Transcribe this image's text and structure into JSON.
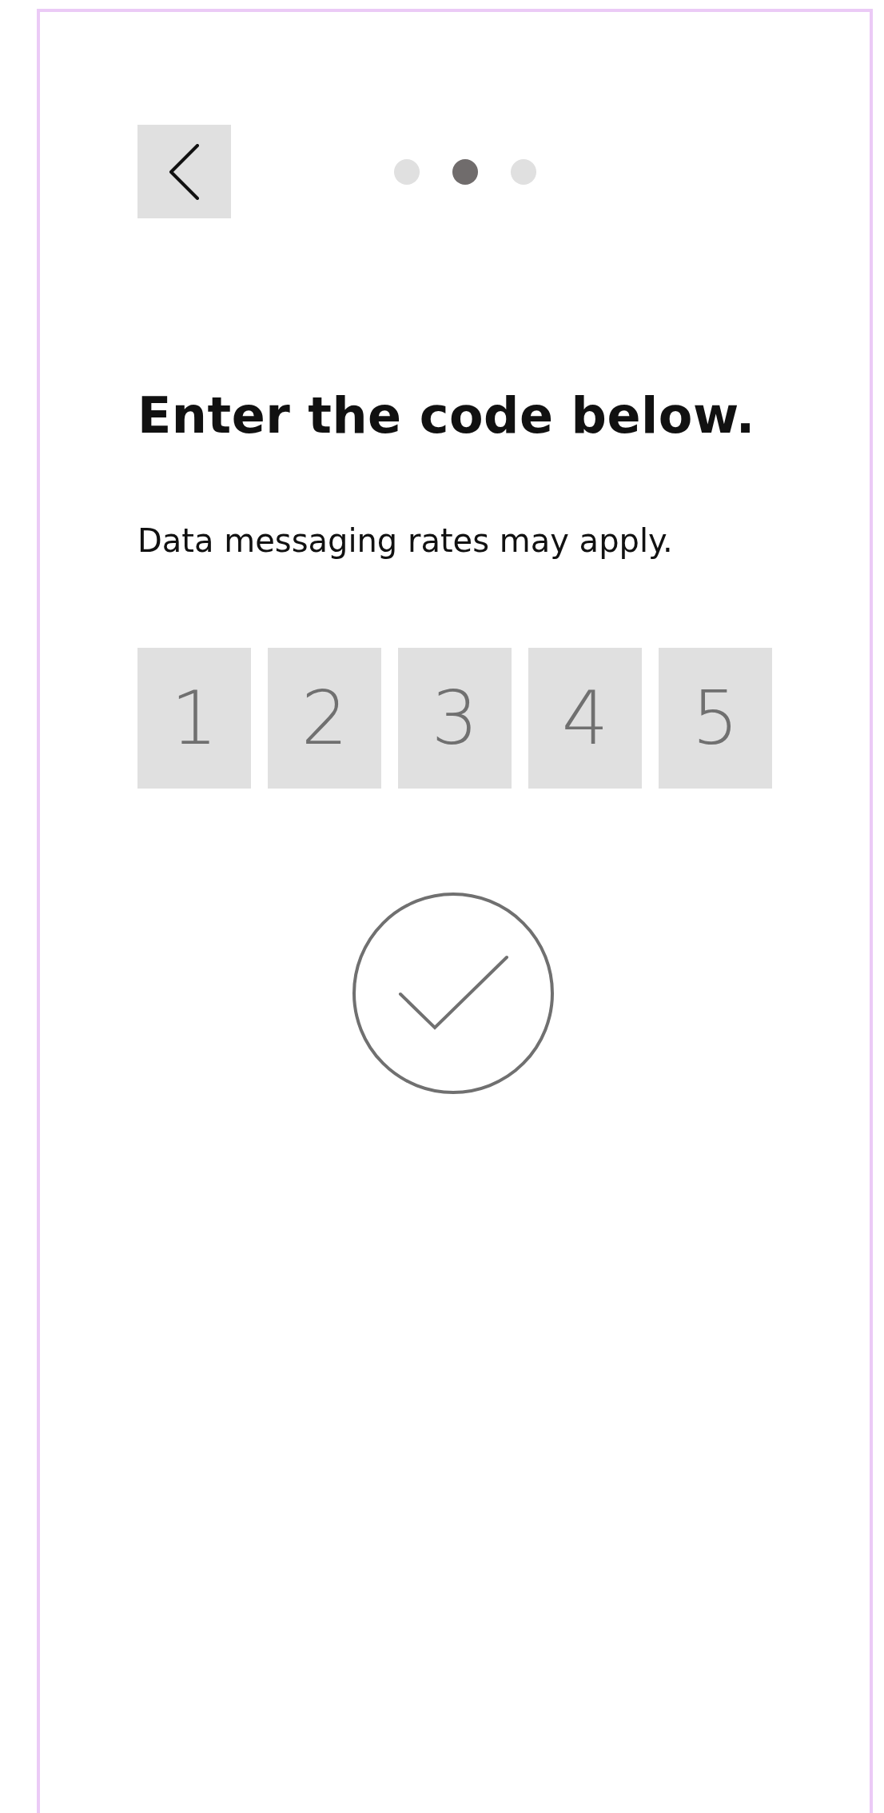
{
  "steps": [
    {
      "selected": false
    },
    {
      "selected": true
    },
    {
      "selected": false
    }
  ],
  "heading": "Enter the code below.",
  "subtitle": "Data messaging rates may apply.",
  "code": [
    "1",
    "2",
    "3",
    "4",
    "5"
  ]
}
